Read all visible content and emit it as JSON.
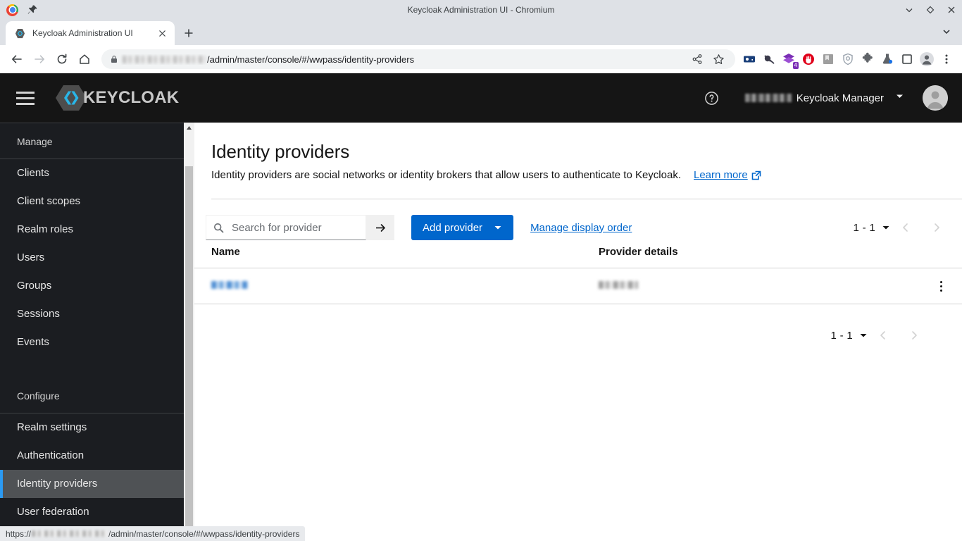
{
  "window": {
    "title": "Keycloak Administration UI - Chromium",
    "controls": {
      "minimize": "minimize",
      "maximize": "maximize",
      "close": "close"
    }
  },
  "browser": {
    "tab": {
      "title": "Keycloak Administration UI",
      "favicon": "keycloak-favicon",
      "close": "close-tab"
    },
    "new_tab": "+",
    "tab_list": "tab-list",
    "nav": {
      "back": "back",
      "forward": "forward",
      "reload": "reload",
      "home": "home"
    },
    "omnibox": {
      "lock": "lock-icon",
      "host_redacted": "",
      "path": "/admin/master/console/#/wwpass/identity-providers",
      "share": "share-icon",
      "bookmark": "star-icon"
    },
    "extensions": [
      {
        "name": "password-manager-extension"
      },
      {
        "name": "adblock-extension"
      },
      {
        "name": "layers-extension",
        "badge": "4"
      },
      {
        "name": "stop-hand-extension"
      },
      {
        "name": "archive-extension"
      },
      {
        "name": "shield-extension"
      },
      {
        "name": "puzzle-extensions-icon"
      },
      {
        "name": "flask-lab-extension"
      },
      {
        "name": "sidepanel-icon"
      }
    ],
    "profile": "profile-avatar",
    "menu": "chrome-menu"
  },
  "keycloak": {
    "brand": "KEYCLOAK",
    "burger": "hamburger-menu",
    "help": "help-icon",
    "user": {
      "name_redacted": "",
      "name": "Keycloak Manager",
      "caret": "chevron-down",
      "avatar": "user-avatar"
    }
  },
  "sidebar": {
    "sections": [
      {
        "title": "Manage",
        "items": [
          {
            "label": "Clients",
            "active": false
          },
          {
            "label": "Client scopes",
            "active": false
          },
          {
            "label": "Realm roles",
            "active": false
          },
          {
            "label": "Users",
            "active": false
          },
          {
            "label": "Groups",
            "active": false
          },
          {
            "label": "Sessions",
            "active": false
          },
          {
            "label": "Events",
            "active": false
          }
        ]
      },
      {
        "title": "Configure",
        "items": [
          {
            "label": "Realm settings",
            "active": false
          },
          {
            "label": "Authentication",
            "active": false
          },
          {
            "label": "Identity providers",
            "active": true
          },
          {
            "label": "User federation",
            "active": false
          }
        ]
      }
    ]
  },
  "main": {
    "title": "Identity providers",
    "description": "Identity providers are social networks or identity brokers that allow users to authenticate to Keycloak.",
    "learn_more": "Learn more",
    "toolbar": {
      "search_placeholder": "Search for provider",
      "search_value": "",
      "search_icon": "search-icon",
      "search_submit": "arrow-right-icon",
      "add_provider": "Add provider",
      "add_provider_caret": "caret-down-icon",
      "manage_display_order": "Manage display order"
    },
    "pagination_top": {
      "range": "1 - 1",
      "caret": "caret-down-icon",
      "prev": "chevron-left-icon",
      "next": "chevron-right-icon"
    },
    "pagination_bottom": {
      "range": "1 - 1",
      "caret": "caret-down-icon",
      "prev": "chevron-left-icon",
      "next": "chevron-right-icon"
    },
    "table": {
      "columns": [
        "Name",
        "Provider details"
      ],
      "rows": [
        {
          "name_redacted": "",
          "details_redacted": "",
          "actions": "kebab-menu"
        }
      ]
    }
  },
  "statusbar": {
    "prefix": "https://",
    "host_redacted": "",
    "path": "/admin/master/console/#/wwpass/identity-providers"
  }
}
